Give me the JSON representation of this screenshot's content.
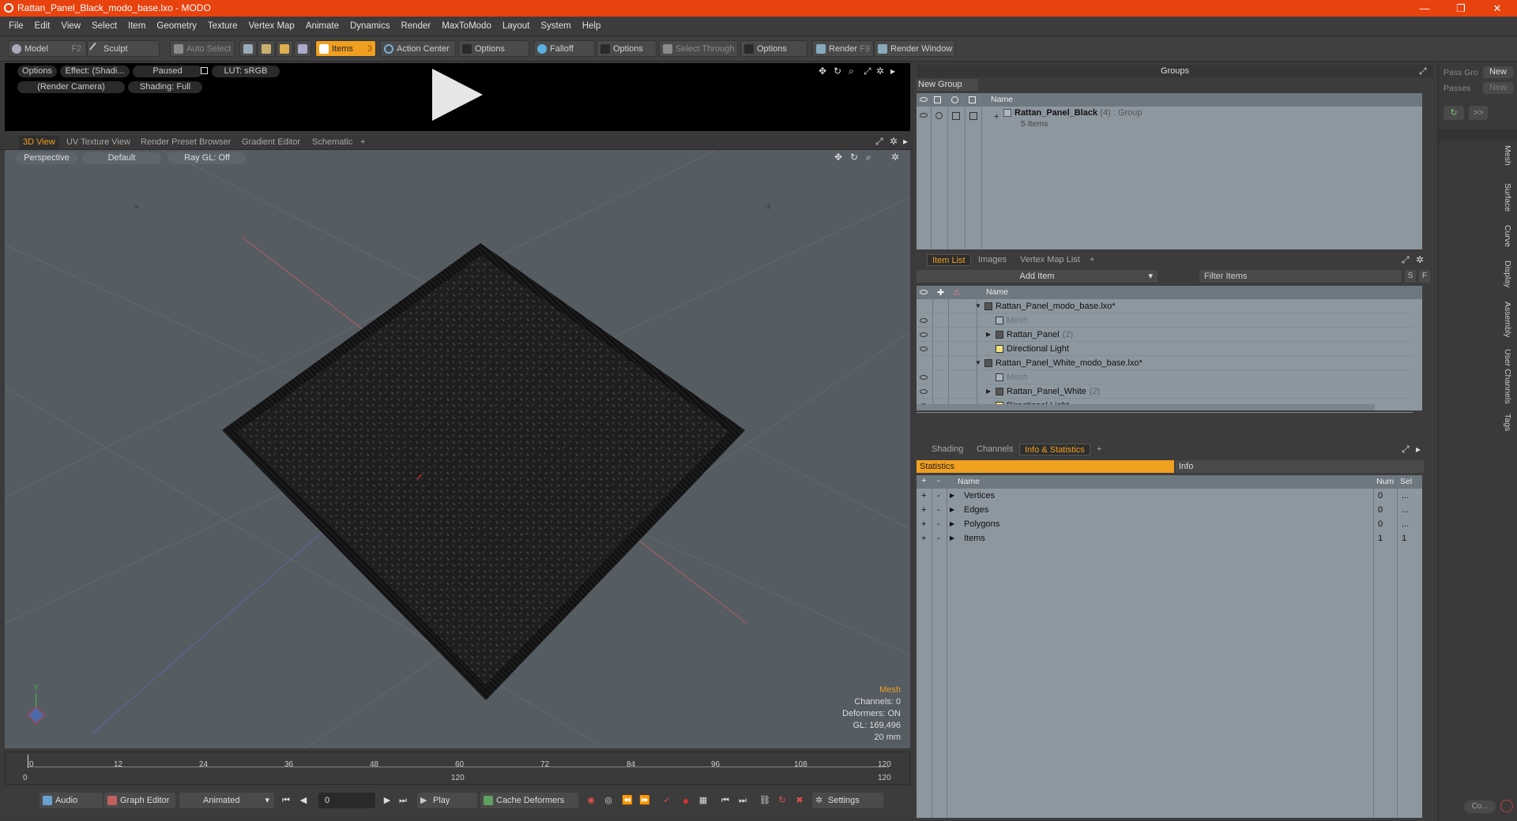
{
  "window": {
    "title": "Rattan_Panel_Black_modo_base.lxo - MODO",
    "minimize": "—",
    "restore": "❐",
    "close": "✕"
  },
  "menu": [
    "File",
    "Edit",
    "View",
    "Select",
    "Item",
    "Geometry",
    "Texture",
    "Vertex Map",
    "Animate",
    "Dynamics",
    "Render",
    "MaxToModo",
    "Layout",
    "System",
    "Help"
  ],
  "toolbar": {
    "model": "Model",
    "model_key": "F2",
    "sculpt": "Sculpt",
    "auto_select": "Auto Select",
    "items": "Items",
    "items_key": "3",
    "action_center": "Action Center",
    "options1": "Options",
    "falloff": "Falloff",
    "options2": "Options",
    "select_through": "Select Through",
    "options3": "Options",
    "render": "Render",
    "render_key": "F9",
    "render_window": "Render Window"
  },
  "preview": {
    "options": "Options",
    "effect": "Effect: (Shadi...",
    "paused": "Paused",
    "lut": "LUT: sRGB",
    "camera": "(Render Camera)",
    "shading": "Shading: Full"
  },
  "viewport_tabs": [
    "3D View",
    "UV Texture View",
    "Render Preset Browser",
    "Gradient Editor",
    "Schematic",
    "+"
  ],
  "viewport": {
    "perspective": "Perspective",
    "default": "Default",
    "raygl": "Ray GL: Off",
    "axis_y": "Y",
    "stats": {
      "mesh": "Mesh",
      "channels": "Channels: 0",
      "deformers": "Deformers: ON",
      "gl": "GL: 169,496",
      "units": "20 mm"
    }
  },
  "timeline": {
    "ticks": [
      "0",
      "12",
      "24",
      "36",
      "48",
      "60",
      "72",
      "84",
      "96",
      "108",
      "120"
    ],
    "start": "0",
    "mid": "120",
    "end": "120"
  },
  "transport": {
    "audio": "Audio",
    "graph_editor": "Graph Editor",
    "animated": "Animated",
    "frame": "0",
    "play": "Play",
    "cache": "Cache Deformers",
    "settings": "Settings"
  },
  "groups": {
    "title": "Groups",
    "new_group": "New Group",
    "col_name": "Name",
    "group_name": "Rattan_Panel_Black",
    "group_count": "(4)",
    "group_type": ": Group",
    "group_items": "5 Items"
  },
  "pass": {
    "pass_label": "Pass Gro",
    "new1": "New",
    "passes_label": "Passes",
    "new2": "New"
  },
  "item_tabs": [
    "Item List",
    "Images",
    "Vertex Map List",
    "+"
  ],
  "item_list": {
    "add_item": "Add Item",
    "filter": "Filter Items",
    "s": "S",
    "f": "F",
    "col_name": "Name",
    "rows": [
      {
        "label": "Rattan_Panel_modo_base.lxo*",
        "indent": 0,
        "dim": false,
        "exp": "▼"
      },
      {
        "label": "Mesh",
        "indent": 1,
        "dim": true,
        "exp": ""
      },
      {
        "label": "Rattan_Panel",
        "count": "(2)",
        "indent": 1,
        "dim": false,
        "exp": "▶"
      },
      {
        "label": "Directional Light",
        "indent": 1,
        "dim": false,
        "exp": ""
      },
      {
        "label": "Rattan_Panel_White_modo_base.lxo*",
        "indent": 0,
        "dim": false,
        "exp": "▼"
      },
      {
        "label": "Mesh",
        "indent": 1,
        "dim": true,
        "exp": ""
      },
      {
        "label": "Rattan_Panel_White",
        "count": "(2)",
        "indent": 1,
        "dim": false,
        "exp": "▶"
      },
      {
        "label": "Directional Light",
        "indent": 1,
        "dim": false,
        "exp": ""
      }
    ]
  },
  "info_tabs": [
    "Shading",
    "Channels",
    "Info & Statistics",
    "+"
  ],
  "stats": {
    "statistics": "Statistics",
    "info": "Info",
    "col_name": "Name",
    "col_num": "Num",
    "col_sel": "Sel",
    "rows": [
      {
        "name": "Vertices",
        "num": "0",
        "sel": "..."
      },
      {
        "name": "Edges",
        "num": "0",
        "sel": "..."
      },
      {
        "name": "Polygons",
        "num": "0",
        "sel": "..."
      },
      {
        "name": "Items",
        "num": "1",
        "sel": "1"
      }
    ]
  },
  "sidebar": {
    "tabs": [
      "Mesh",
      "Surface",
      "Curve",
      "Display",
      "Assembly",
      "User Channels",
      "Tags"
    ],
    "co": "Co...",
    "arrow": ">>"
  }
}
